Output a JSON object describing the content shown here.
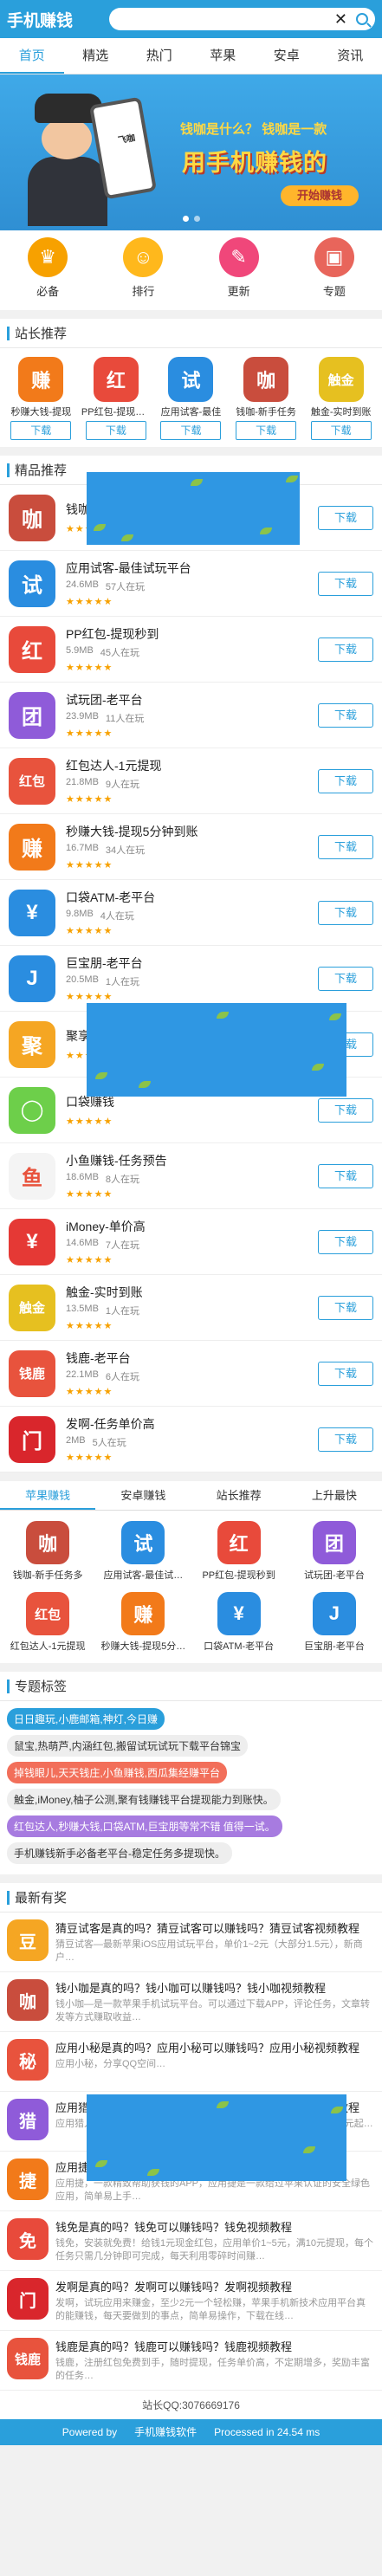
{
  "header": {
    "title": "手机赚钱",
    "search_placeholder": ""
  },
  "nav": [
    "首页",
    "精选",
    "热门",
    "苹果",
    "安卓",
    "资讯"
  ],
  "banner": {
    "phone_label": "飞咖",
    "line1_a": "钱咖是什么？",
    "line1_b": "钱咖是一款",
    "line2": "用手机赚钱的",
    "button": "开始赚钱"
  },
  "quick": [
    {
      "label": "必备",
      "color": "#f7a100",
      "icon": "crown-icon"
    },
    {
      "label": "排行",
      "color": "#ffb81c",
      "icon": "ghost-icon"
    },
    {
      "label": "更新",
      "color": "#f0477a",
      "icon": "edit-icon"
    },
    {
      "label": "专题",
      "color": "#e8655b",
      "icon": "briefcase-icon"
    }
  ],
  "recommend": {
    "title": "站长推荐",
    "download": "下载",
    "items": [
      {
        "name": "秒赚大钱-提现",
        "glyph": "赚",
        "color": "#f27a1a"
      },
      {
        "name": "PP红包-提现秒到",
        "glyph": "红",
        "color": "#e84a3b"
      },
      {
        "name": "应用试客-最佳",
        "glyph": "试",
        "color": "#2a8de0"
      },
      {
        "name": "钱咖-新手任务",
        "glyph": "咖",
        "color": "#c94d3d"
      },
      {
        "name": "触金-实时到账",
        "glyph": "触金",
        "color": "#e6c020"
      }
    ]
  },
  "featured": {
    "title": "精品推荐",
    "download": "下载",
    "stars": "★★★★★",
    "apps": [
      {
        "name": "钱咖-老平台",
        "size": "",
        "users": "",
        "glyph": "咖",
        "color": "#c94d3d"
      },
      {
        "name": "应用试客-最佳试玩平台",
        "size": "24.6MB",
        "users": "57人在玩",
        "glyph": "试",
        "color": "#2a8de0"
      },
      {
        "name": "PP红包-提现秒到",
        "size": "5.9MB",
        "users": "45人在玩",
        "glyph": "红",
        "color": "#e84a3b"
      },
      {
        "name": "试玩团-老平台",
        "size": "23.9MB",
        "users": "11人在玩",
        "glyph": "团",
        "color": "#8f5bd9"
      },
      {
        "name": "红包达人-1元提现",
        "size": "21.8MB",
        "users": "9人在玩",
        "glyph": "红包",
        "color": "#e8533d"
      },
      {
        "name": "秒赚大钱-提现5分钟到账",
        "size": "16.7MB",
        "users": "34人在玩",
        "glyph": "赚",
        "color": "#f27a1a"
      },
      {
        "name": "口袋ATM-老平台",
        "size": "9.8MB",
        "users": "4人在玩",
        "glyph": "¥",
        "color": "#2a8de0"
      },
      {
        "name": "巨宝朋-老平台",
        "size": "20.5MB",
        "users": "1人在玩",
        "glyph": "J",
        "color": "#2a8de0"
      },
      {
        "name": "聚享游-老平台",
        "size": "",
        "users": "",
        "glyph": "聚",
        "color": "#f5a623"
      },
      {
        "name": "口袋赚钱",
        "size": "",
        "users": "",
        "glyph": "◯",
        "color": "#6dcf4a"
      },
      {
        "name": "小鱼赚钱-任务预告",
        "size": "18.6MB",
        "users": "8人在玩",
        "glyph": "鱼",
        "color": "#f4f4f4"
      },
      {
        "name": "iMoney-单价高",
        "size": "14.6MB",
        "users": "7人在玩",
        "glyph": "¥",
        "color": "#e53935"
      },
      {
        "name": "触金-实时到账",
        "size": "13.5MB",
        "users": "1人在玩",
        "glyph": "触金",
        "color": "#e6c020"
      },
      {
        "name": "钱鹿-老平台",
        "size": "22.1MB",
        "users": "6人在玩",
        "glyph": "钱鹿",
        "color": "#e8533d"
      },
      {
        "name": "发啊-任务单价高",
        "size": "2MB",
        "users": "5人在玩",
        "glyph": "门",
        "color": "#d9262c"
      }
    ]
  },
  "tabs2": {
    "labels": [
      "苹果赚钱",
      "安卓赚钱",
      "站长推荐",
      "上升最快"
    ],
    "items": [
      {
        "name": "钱咖-新手任务多",
        "glyph": "咖",
        "color": "#c94d3d"
      },
      {
        "name": "应用试客-最佳试…",
        "glyph": "试",
        "color": "#2a8de0"
      },
      {
        "name": "PP红包-提现秒到",
        "glyph": "红",
        "color": "#e84a3b"
      },
      {
        "name": "试玩团-老平台",
        "glyph": "团",
        "color": "#8f5bd9"
      },
      {
        "name": "红包达人-1元提现",
        "glyph": "红包",
        "color": "#e8533d"
      },
      {
        "name": "秒赚大钱-提现5分…",
        "glyph": "赚",
        "color": "#f27a1a"
      },
      {
        "name": "口袋ATM-老平台",
        "glyph": "¥",
        "color": "#2a8de0"
      },
      {
        "name": "巨宝朋-老平台",
        "glyph": "J",
        "color": "#2a8de0"
      }
    ]
  },
  "topics": {
    "title": "专题标签",
    "lines": [
      {
        "text": "日日趣玩,小鹿邮箱,神灯,今日赚",
        "bg": "#2a9fdb",
        "fg": "#fff"
      },
      {
        "text": "鼠宝,热萌芦,内涵红包,搬留试玩试玩下载平台锦宝",
        "bg": "#eee",
        "fg": "#333"
      },
      {
        "text": "掉钱眼儿,天天钱庄,小鱼赚钱,西瓜集经赚平台",
        "bg": "#f26f5a",
        "fg": "#fff"
      },
      {
        "text": "触金,iMoney,柚子公测,聚有钱赚钱平台提现能力到账快。",
        "bg": "#eee",
        "fg": "#333"
      },
      {
        "text": "红包达人,秒赚大钱,口袋ATM,巨宝朋等常不错 值得一试。",
        "bg": "#a77be0",
        "fg": "#fff"
      },
      {
        "text": "手机赚钱新手必备老平台-稳定任务多提现快。",
        "bg": "#eee",
        "fg": "#333"
      }
    ]
  },
  "news": {
    "title": "最新有奖",
    "items": [
      {
        "title": "猜豆试客是真的吗？猜豆试客可以赚钱吗？猜豆试客视频教程",
        "desc": "猜豆试客—最新苹果iOS应用试玩平台，单价1~2元（大部分1.5元），新商户…",
        "glyph": "豆",
        "color": "#f5a623"
      },
      {
        "title": "钱小咖是真的吗？钱小咖可以赚钱吗？钱小咖视频教程",
        "desc": "钱小咖—是一款苹果手机试玩平台。可以通过下载APP，评论任务，文章转发等方式赚取收益…",
        "glyph": "咖",
        "color": "#c94d3d"
      },
      {
        "title": "应用小秘是真的吗？应用小秘可以赚钱吗？应用小秘视频教程",
        "desc": "应用小秘，分享QQ空间…",
        "glyph": "秘",
        "color": "#e8533d"
      },
      {
        "title": "应用猎人是真的吗？应用猎人可以赚钱吗？应用猎人视频教程",
        "desc": "应用猎人，2017最新苹果手机应用试玩平台，新人送1元，任务单价1元起…",
        "glyph": "猎",
        "color": "#8f5bd9"
      },
      {
        "title": "应用捷是真的吗？应用捷可以赚钱吗？应用捷视频教程",
        "desc": "应用捷，一款精致帮助获钱的APP，应用捷是一款给过苹果认证的安全绿色应用，简单易上手…",
        "glyph": "捷",
        "color": "#f27a1a"
      },
      {
        "title": "钱免是真的吗？钱免可以赚钱吗？钱免视频教程",
        "desc": "钱免，安装就免费！给钱1元现金红包，应用单价1~5元，满10元提现，每个任务只需几分钟即可完成，每天利用零碎时间赚…",
        "glyph": "免",
        "color": "#e84a3b"
      },
      {
        "title": "发啊是真的吗？发啊可以赚钱吗？发啊视频教程",
        "desc": "发啊，试玩应用来赚金，至少2元一个轻松赚，苹果手机新技术应用平台真的能赚钱，每天要做到的事点，简单易操作，下载在线…",
        "glyph": "门",
        "color": "#d9262c"
      },
      {
        "title": "钱鹿是真的吗？钱鹿可以赚钱吗？钱鹿视频教程",
        "desc": "钱鹿，注册红包免费到手，随时提现，任务单价高，不定期增多，奖励丰富的任务…",
        "glyph": "钱鹿",
        "color": "#e8533d"
      }
    ]
  },
  "footer": {
    "qq": "站长QQ:3076669176",
    "powered": "Powered by",
    "site": "手机赚钱软件",
    "processed": "Processed in 24.54 ms"
  }
}
